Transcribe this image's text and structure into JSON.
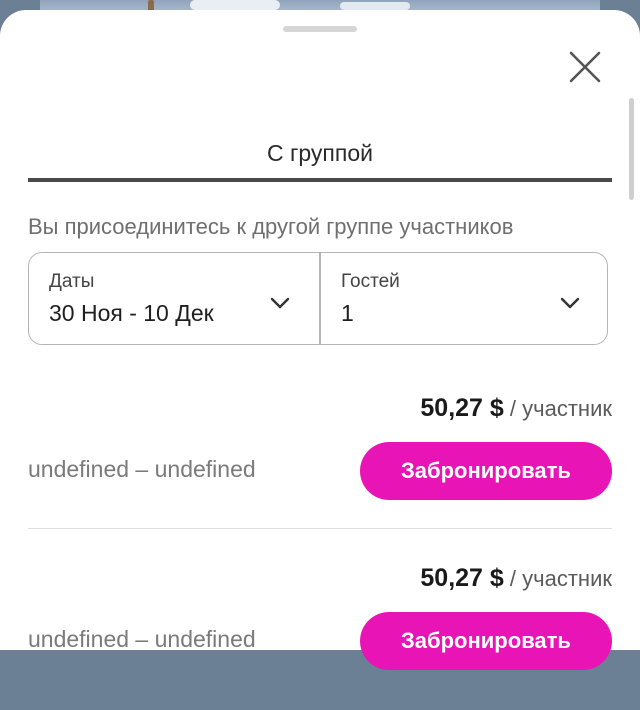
{
  "sheet": {
    "tab_label": "С группой",
    "intro": "Вы присоединитесь к другой группе участников"
  },
  "selector": {
    "dates_label": "Даты",
    "dates_value": "30 Ноя - 10 Дек",
    "guests_label": "Гостей",
    "guests_value": "1"
  },
  "offers": [
    {
      "price": "50,27 $",
      "unit": " / участник",
      "dates": "undefined – undefined",
      "button": "Забронировать"
    },
    {
      "price": "50,27 $",
      "unit": " / участник",
      "dates": "undefined – undefined",
      "button": "Забронировать"
    }
  ],
  "icons": {
    "close": "close-icon",
    "chevron": "chevron-down-icon"
  },
  "colors": {
    "accent": "#e814b5",
    "tab_underline": "#4a4a4a"
  }
}
